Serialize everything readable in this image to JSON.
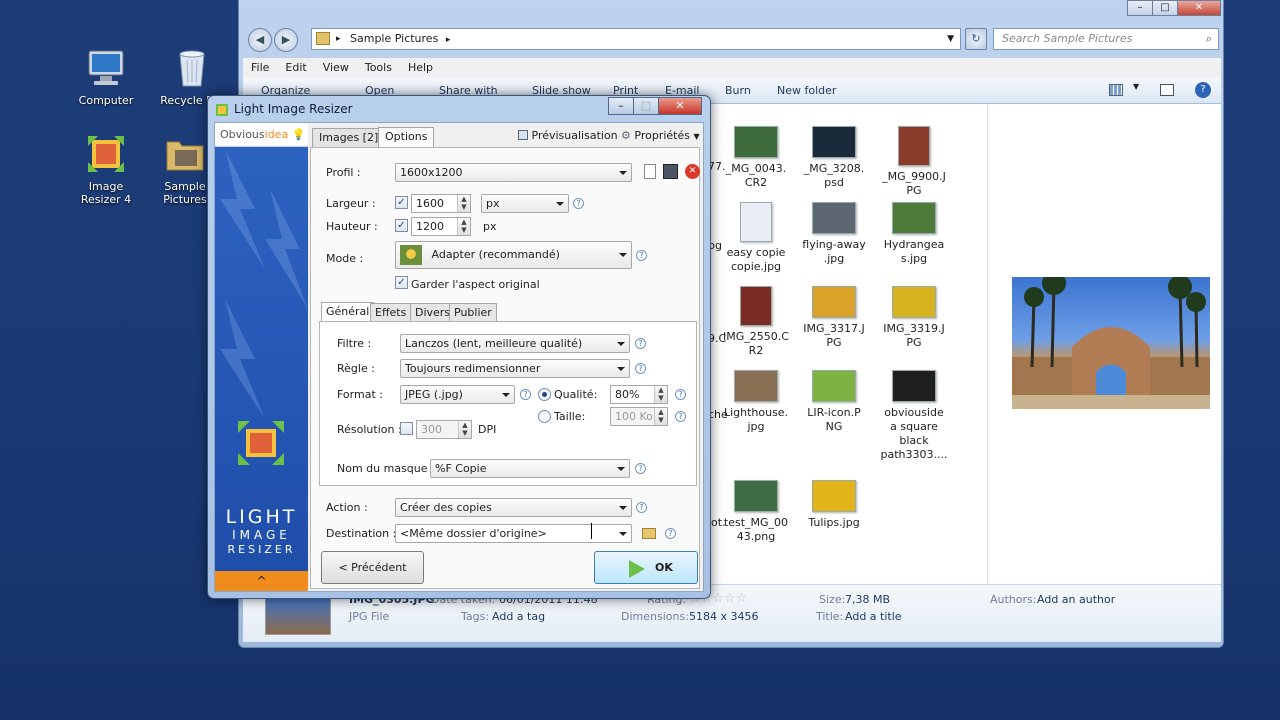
{
  "desktop": {
    "icons": [
      {
        "label": "Computer"
      },
      {
        "label": "Recycle Bin"
      },
      {
        "label": "Image Resizer 4"
      },
      {
        "label": "Sample Pictures"
      }
    ]
  },
  "explorer": {
    "address": "Sample Pictures",
    "search_placeholder": "Search Sample Pictures",
    "window_buttons": {
      "minimize": "–",
      "maximize": "□",
      "close": "✕"
    },
    "menu": [
      "File",
      "Edit",
      "View",
      "Tools",
      "Help"
    ],
    "toolbar": {
      "organize": "Organize",
      "open": "Open",
      "share": "Share with",
      "slideshow": "Slide show",
      "print": "Print",
      "email": "E-mail",
      "burn": "Burn",
      "newfolder": "New folder"
    },
    "partial_labels": [
      "77.",
      "pg",
      "9.C",
      "che",
      "iot."
    ],
    "files": [
      {
        "name": "_MG_0043.\nCR2",
        "color": "#3c6a3a"
      },
      {
        "name": "_MG_3208.\npsd",
        "color": "#1b2a3b"
      },
      {
        "name": "_MG_9900.J\nPG",
        "color": "#8a3b2a"
      },
      {
        "name": "easy copie\ncopie.jpg",
        "color": "#e9eef6"
      },
      {
        "name": "flying-away\n.jpg",
        "color": "#5b6670"
      },
      {
        "name": "Hydrangea\ns.jpg",
        "color": "#4f7b3a"
      },
      {
        "name": "IMG_2550.C\nR2",
        "color": "#7a2b22"
      },
      {
        "name": "IMG_3317.J\nPG",
        "color": "#d9a32a"
      },
      {
        "name": "IMG_3319.J\nPG",
        "color": "#d8b21f"
      },
      {
        "name": "Lighthouse.\njpg",
        "color": "#8a6e52"
      },
      {
        "name": "LIR-icon.P\nNG",
        "color": "#7cb342"
      },
      {
        "name": "obviouside\na square\nblack\npath3303....",
        "color": "#1f1f1f"
      },
      {
        "name": "test_MG_00\n43.png",
        "color": "#3f6d44"
      },
      {
        "name": "Tulips.jpg",
        "color": "#e1b419"
      }
    ],
    "details": {
      "filename": "IMG_0305.JPG",
      "date_label": "Date taken:",
      "date": "06/01/2011 11:48",
      "filetype": "JPG File",
      "rating_label": "Rating:",
      "tags_label": "Tags:",
      "tags": "Add a tag",
      "dim_label": "Dimensions:",
      "dim": "5184 x 3456",
      "size_label": "Size:",
      "size": "7,38 MB",
      "title_label": "Title:",
      "title": "Add a title",
      "authors_label": "Authors:",
      "authors": "Add an author"
    }
  },
  "dialog": {
    "title": "Light Image Resizer",
    "window_buttons": {
      "minimize": "–",
      "maximize": "□",
      "close": "✕"
    },
    "brand": "Obviousidea",
    "brand_part1": "Obvious",
    "brand_part2": "idea",
    "tabs": [
      "Images [2]",
      "Options"
    ],
    "preview": "Prévisualisation",
    "properties": "Propriétés",
    "logo_lines": [
      "LIGHT",
      "IMAGE",
      "RESIZER"
    ],
    "collapse": "^",
    "profile_label": "Profil :",
    "profile": "1600x1200",
    "width_label": "Largeur :",
    "width": "1600",
    "unit": "px",
    "height_label": "Hauteur :",
    "height": "1200",
    "height_unit": "px",
    "mode_label": "Mode :",
    "mode": "Adapter (recommandé)",
    "keep_aspect": "Garder l'aspect original",
    "inner_tabs": [
      "Général",
      "Effets",
      "Divers",
      "Publier"
    ],
    "filter_label": "Filtre :",
    "filter": "Lanczos  (lent, meilleure qualité)",
    "rule_label": "Règle :",
    "rule": "Toujours redimensionner",
    "format_label": "Format :",
    "format": "JPEG (.jpg)",
    "quality_label": "Qualité:",
    "quality": "80%",
    "size_label": "Taille:",
    "size": "100 Ko",
    "resolution_label": "Résolution :",
    "resolution": "300",
    "dpi": "DPI",
    "mask_label": "Nom du masque :",
    "mask": "%F Copie",
    "action_label": "Action :",
    "action": "Créer des copies",
    "dest_label": "Destination :",
    "dest": "<Même dossier d'origine>",
    "prev_button": "< Précédent",
    "ok_button": "OK"
  }
}
